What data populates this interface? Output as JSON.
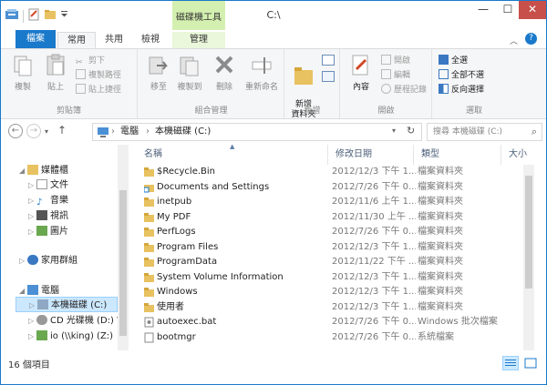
{
  "window": {
    "title": "C:\\",
    "context_tab_title": "磁碟機工具",
    "controls": {
      "minimize": "—",
      "maximize": "☐",
      "close": "✕"
    }
  },
  "ribbon_tabs": [
    {
      "label": "檔案"
    },
    {
      "label": "常用"
    },
    {
      "label": "共用"
    },
    {
      "label": "檢視"
    },
    {
      "label": "管理"
    }
  ],
  "ribbon": {
    "clipboard": {
      "label": "剪貼簿",
      "copy": "複製",
      "paste": "貼上",
      "cut": "剪下",
      "copy_path": "複製路徑",
      "paste_shortcut": "貼上捷徑"
    },
    "organize": {
      "label": "組合管理",
      "move_to": "移至",
      "copy_to": "複製到",
      "delete": "刪除",
      "rename": "重新命名"
    },
    "new": {
      "label": "新增",
      "new_folder": "新增\n資料夾"
    },
    "open": {
      "label": "開啟",
      "properties": "內容",
      "open": "開啟",
      "edit": "編輯",
      "history": "歷程記錄"
    },
    "select": {
      "label": "選取",
      "select_all": "全選",
      "select_none": "全部不選",
      "invert": "反向選擇"
    }
  },
  "address": {
    "crumbs": [
      "電腦",
      "本機磁碟 (C:)"
    ],
    "search_placeholder": "搜尋 本機磁碟 (C:)"
  },
  "nav_pane": {
    "libraries": "媒體櫃",
    "documents": "文件",
    "music": "音樂",
    "videos": "視訊",
    "pictures": "圖片",
    "homegroup": "家用群組",
    "computer": "電腦",
    "local_disk": "本機磁碟 (C:)",
    "cd_drive": "CD 光碟機 (D:) V",
    "network_drive": "io (\\\\king) (Z:)"
  },
  "columns": {
    "name": "名稱",
    "date": "修改日期",
    "type": "類型",
    "size": "大小"
  },
  "files": [
    {
      "name": "$Recycle.Bin",
      "date": "2012/12/3 下午 1...",
      "type": "檔案資料夾",
      "icon": "folder-icon"
    },
    {
      "name": "Documents and Settings",
      "date": "2012/7/26 下午 0...",
      "type": "檔案資料夾",
      "icon": "shortcut-folder-icon"
    },
    {
      "name": "inetpub",
      "date": "2012/11/6 上午 1...",
      "type": "檔案資料夾",
      "icon": "folder-icon"
    },
    {
      "name": "My PDF",
      "date": "2012/11/30 上午 ...",
      "type": "檔案資料夾",
      "icon": "folder-icon"
    },
    {
      "name": "PerfLogs",
      "date": "2012/7/26 下午 0...",
      "type": "檔案資料夾",
      "icon": "folder-icon"
    },
    {
      "name": "Program Files",
      "date": "2012/12/3 下午 1...",
      "type": "檔案資料夾",
      "icon": "folder-icon"
    },
    {
      "name": "ProgramData",
      "date": "2012/11/22 下午 ...",
      "type": "檔案資料夾",
      "icon": "folder-icon"
    },
    {
      "name": "System Volume Information",
      "date": "2012/12/3 下午 1...",
      "type": "檔案資料夾",
      "icon": "folder-icon"
    },
    {
      "name": "Windows",
      "date": "2012/12/3 下午 1...",
      "type": "檔案資料夾",
      "icon": "folder-icon"
    },
    {
      "name": "使用者",
      "date": "2012/12/3 下午 1...",
      "type": "檔案資料夾",
      "icon": "folder-icon"
    },
    {
      "name": "autoexec.bat",
      "date": "2012/7/26 下午 0...",
      "type": "Windows 批次檔案",
      "icon": "batch-file-icon"
    },
    {
      "name": "bootmgr",
      "date": "2012/7/26 下午 0...",
      "type": "系統檔案",
      "icon": "system-file-icon"
    }
  ],
  "status": {
    "item_count": "16 個項目"
  },
  "colors": {
    "accent": "#1979ca",
    "context_tab": "#d4f0b0",
    "selection": "#cce8ff",
    "folder": "#e8c160"
  }
}
